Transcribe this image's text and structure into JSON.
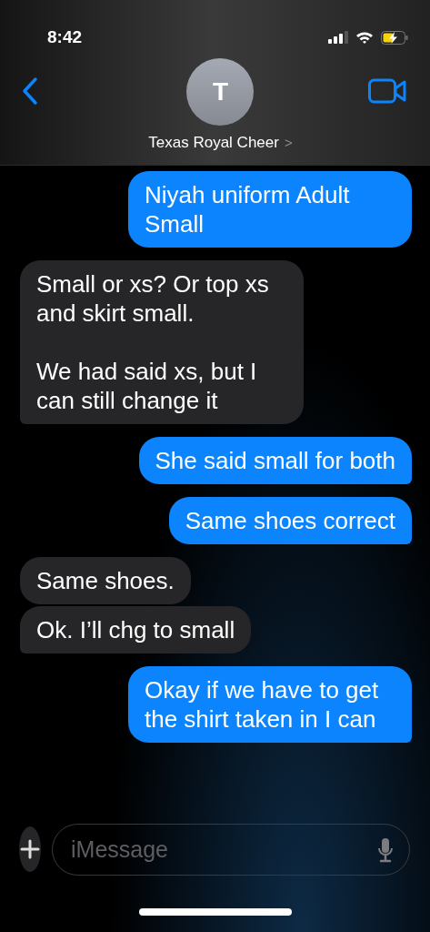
{
  "status_bar": {
    "time": "8:42"
  },
  "header": {
    "avatar_initial": "T",
    "contact_name": "Texas Royal Cheer",
    "chevron": ">"
  },
  "messages": [
    {
      "kind": "sent",
      "text": "Niyah uniform Adult Small",
      "tail": false
    },
    {
      "kind": "received",
      "text": "Small or xs? Or top xs and skirt small.\n\nWe had said xs, but I can still change it",
      "tail": true
    },
    {
      "kind": "sent",
      "text": "She said small for both",
      "tail": true
    },
    {
      "kind": "sent",
      "text": "Same shoes correct",
      "tail": true
    },
    {
      "kind": "received",
      "text": "Same shoes.",
      "tail": false
    },
    {
      "kind": "received",
      "text": "Ok. I’ll chg to small",
      "tail": true
    },
    {
      "kind": "sent",
      "text": "Okay if we have to get the shirt taken in I can",
      "tail": true
    }
  ],
  "composer": {
    "placeholder": "iMessage"
  }
}
